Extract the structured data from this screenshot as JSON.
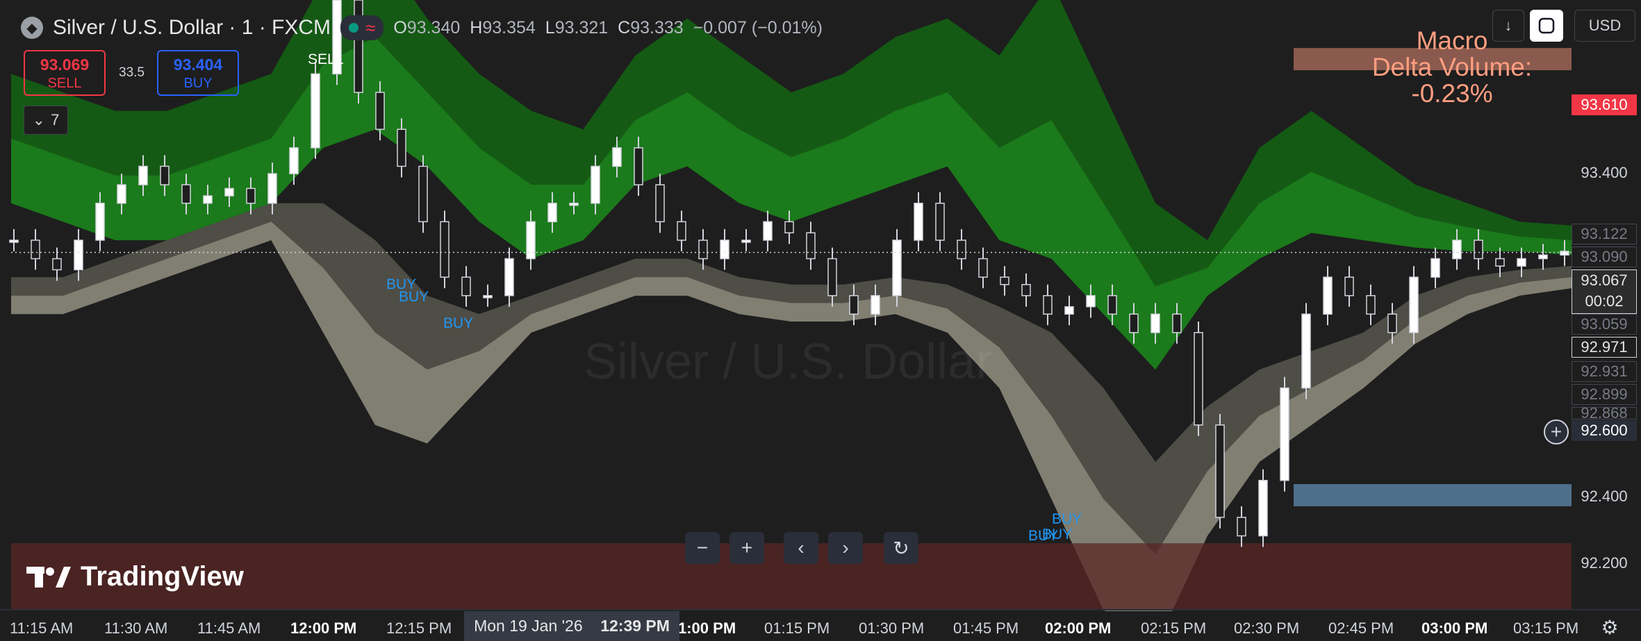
{
  "header": {
    "symbol_title": "Silver / U.S. Dollar · 1 · FXCM",
    "ohlc": [
      {
        "label": "O",
        "value": "93.340"
      },
      {
        "label": "H",
        "value": "93.354"
      },
      {
        "label": "L",
        "value": "93.321"
      },
      {
        "label": "C",
        "value": "93.333"
      }
    ],
    "change": "−0.007 (−0.01%)",
    "logo_icon": "silver-coin-icon",
    "status_icon": "market-open-dot-icon",
    "wave_icon": "wave-icon"
  },
  "trade": {
    "sell_price": "93.069",
    "sell_label": "SELL",
    "spread": "33.5",
    "buy_price": "93.404",
    "buy_label": "BUY"
  },
  "indicators_toggle": {
    "count": "7",
    "icon": "chevron-down-icon"
  },
  "top_right": {
    "download_icon": "download-arrow-icon",
    "fullscreen_icon": "fullscreen-icon",
    "currency": "USD"
  },
  "macro_label": {
    "line1": "Macro",
    "line2": "Delta Volume:",
    "line3": "-0.23%"
  },
  "watermark": "Silver / U.S. Dollar",
  "price_axis": {
    "labels": [
      "93.400",
      "92.400",
      "92.200"
    ],
    "levels": [
      "93.122",
      "93.090",
      "93.059",
      "92.931",
      "92.899",
      "92.868"
    ],
    "top_red_level": "93.610",
    "current_price": "93.067",
    "countdown": "00:02",
    "boxed_level": "92.971",
    "cursor_level": "92.600",
    "plus_icon": "plus-circle-icon"
  },
  "signals": [
    {
      "text": "SELL",
      "type": "sell"
    },
    {
      "text": "BUY",
      "type": "buy"
    },
    {
      "text": "BUY",
      "type": "buy"
    },
    {
      "text": "BUY",
      "type": "buy"
    },
    {
      "text": "BUY",
      "type": "buy"
    },
    {
      "text": "BUY",
      "type": "buy"
    },
    {
      "text": "BUY",
      "type": "buy"
    }
  ],
  "nav_controls": [
    {
      "name": "zoom-out",
      "icon": "minus-icon",
      "glyph": "−"
    },
    {
      "name": "zoom-in",
      "icon": "plus-icon",
      "glyph": "+"
    },
    {
      "name": "scroll-left",
      "icon": "chevron-left-icon",
      "glyph": "‹"
    },
    {
      "name": "scroll-right",
      "icon": "chevron-right-icon",
      "glyph": "›"
    },
    {
      "name": "reset",
      "icon": "reset-icon",
      "glyph": "↻"
    }
  ],
  "brand": {
    "name": "TradingView",
    "icon": "tradingview-logo-icon"
  },
  "time_axis": {
    "labels": [
      {
        "text": "11:15 AM",
        "bold": false
      },
      {
        "text": "11:30 AM",
        "bold": false
      },
      {
        "text": "11:45 AM",
        "bold": false
      },
      {
        "text": "12:00 PM",
        "bold": true
      },
      {
        "text": "12:15 PM",
        "bold": false
      },
      {
        "text": "1:00 PM",
        "bold": true
      },
      {
        "text": "01:15 PM",
        "bold": false
      },
      {
        "text": "01:30 PM",
        "bold": false
      },
      {
        "text": "01:45 PM",
        "bold": false
      },
      {
        "text": "02:00 PM",
        "bold": true
      },
      {
        "text": "02:15 PM",
        "bold": false
      },
      {
        "text": "02:30 PM",
        "bold": false
      },
      {
        "text": "02:45 PM",
        "bold": false
      },
      {
        "text": "03:00 PM",
        "bold": true
      },
      {
        "text": "03:15 PM",
        "bold": false
      }
    ],
    "cursor_date": "Mon 19 Jan '26",
    "cursor_time": "12:39 PM",
    "settings_icon": "settings-gear-icon"
  },
  "colors": {
    "bg": "#1e1e1e",
    "green_band": "#1b7a1b",
    "green_band_outer": "#145a14",
    "gray_band": "#8a887a",
    "gray_band_outer": "#4e4d46",
    "sell_red": "#f23645",
    "buy_blue": "#2962ff",
    "signal_blue": "#2196f3",
    "macro_orange": "#ff9e80",
    "zone_brown": "#8b5a4e",
    "zone_blue": "#4e6f8b",
    "bottom_zone": "#5a2626"
  },
  "chart_data": {
    "type": "candlestick",
    "instrument": "Silver / U.S. Dollar",
    "timeframe": "1",
    "ylim": [
      92.1,
      93.75
    ],
    "y_ticks": [
      93.4,
      92.4,
      92.2
    ],
    "x_range": [
      "11:12 AM",
      "03:18 PM"
    ],
    "x_ticks": [
      "11:15 AM",
      "11:30 AM",
      "11:45 AM",
      "12:00 PM",
      "12:15 PM",
      "1:00 PM",
      "01:15 PM",
      "01:30 PM",
      "01:45 PM",
      "02:00 PM",
      "02:15 PM",
      "02:30 PM",
      "02:45 PM",
      "03:00 PM",
      "03:15 PM"
    ],
    "current_price": 93.067,
    "ohlc_last": {
      "open": 93.34,
      "high": 93.354,
      "low": 93.321,
      "close": 93.333
    },
    "candles": [
      93.1,
      93.05,
      93.02,
      93.1,
      93.2,
      93.25,
      93.3,
      93.25,
      93.2,
      93.22,
      93.24,
      93.2,
      93.28,
      93.35,
      93.55,
      93.75,
      93.5,
      93.4,
      93.3,
      93.15,
      93.0,
      92.95,
      92.95,
      93.05,
      93.15,
      93.2,
      93.2,
      93.3,
      93.35,
      93.25,
      93.15,
      93.1,
      93.05,
      93.1,
      93.1,
      93.15,
      93.12,
      93.05,
      92.95,
      92.9,
      92.95,
      93.1,
      93.2,
      93.1,
      93.05,
      93.0,
      92.98,
      92.95,
      92.9,
      92.92,
      92.95,
      92.9,
      92.85,
      92.9,
      92.85,
      92.6,
      92.35,
      92.3,
      92.45,
      92.7,
      92.9,
      93.0,
      92.95,
      92.9,
      92.85,
      93.0,
      93.05,
      93.1,
      93.05,
      93.03,
      93.05,
      93.06,
      93.07
    ],
    "bands": {
      "upper_green": [
        93.55,
        93.5,
        93.45,
        93.45,
        93.5,
        93.55,
        93.8,
        93.9,
        93.7,
        93.55,
        93.45,
        93.4,
        93.6,
        93.7,
        93.6,
        93.5,
        93.55,
        93.65,
        93.7,
        93.6,
        93.8,
        93.5,
        93.2,
        93.1,
        93.35,
        93.45,
        93.35,
        93.25,
        93.2,
        93.15,
        93.14
      ],
      "lower_green": [
        93.2,
        93.15,
        93.1,
        93.1,
        93.15,
        93.2,
        93.35,
        93.4,
        93.3,
        93.15,
        93.05,
        93.1,
        93.25,
        93.3,
        93.2,
        93.15,
        93.2,
        93.25,
        93.3,
        93.1,
        93.05,
        92.9,
        92.75,
        92.95,
        93.05,
        93.12,
        93.1,
        93.08,
        93.07,
        93.07,
        93.06
      ],
      "upper_gray": [
        93.0,
        93.0,
        93.05,
        93.1,
        93.15,
        93.2,
        93.2,
        93.1,
        92.95,
        92.9,
        92.95,
        93.0,
        93.05,
        93.05,
        93.0,
        92.98,
        92.98,
        93.0,
        92.98,
        92.92,
        92.85,
        92.7,
        92.5,
        92.65,
        92.75,
        92.8,
        92.85,
        92.95,
        93.0,
        93.02,
        93.03
      ],
      "lower_gray": [
        92.9,
        92.9,
        92.95,
        93.0,
        93.05,
        93.1,
        92.85,
        92.6,
        92.55,
        92.7,
        92.85,
        92.9,
        92.95,
        92.95,
        92.9,
        92.88,
        92.88,
        92.9,
        92.85,
        92.7,
        92.4,
        92.1,
        92.0,
        92.3,
        92.5,
        92.6,
        92.7,
        92.82,
        92.9,
        92.95,
        92.97
      ]
    },
    "zones": [
      {
        "name": "macro-resistance",
        "from": 93.56,
        "to": 93.62
      },
      {
        "name": "macro-support",
        "from": 92.38,
        "to": 92.44
      },
      {
        "name": "bottom-zone",
        "from": 92.1,
        "to": 92.28
      }
    ],
    "signal_markers": [
      {
        "label": "SELL",
        "time_index": 15,
        "price": 93.75
      },
      {
        "label": "BUY",
        "time_index": 20,
        "price": 92.98
      },
      {
        "label": "BUY",
        "time_index": 21,
        "price": 92.95
      },
      {
        "label": "BUY",
        "time_index": 24,
        "price": 92.9
      },
      {
        "label": "BUY",
        "time_index": 56,
        "price": 92.33
      },
      {
        "label": "BUY",
        "time_index": 57,
        "price": 92.3
      },
      {
        "label": "BUY",
        "time_index": 58,
        "price": 92.35
      }
    ]
  }
}
